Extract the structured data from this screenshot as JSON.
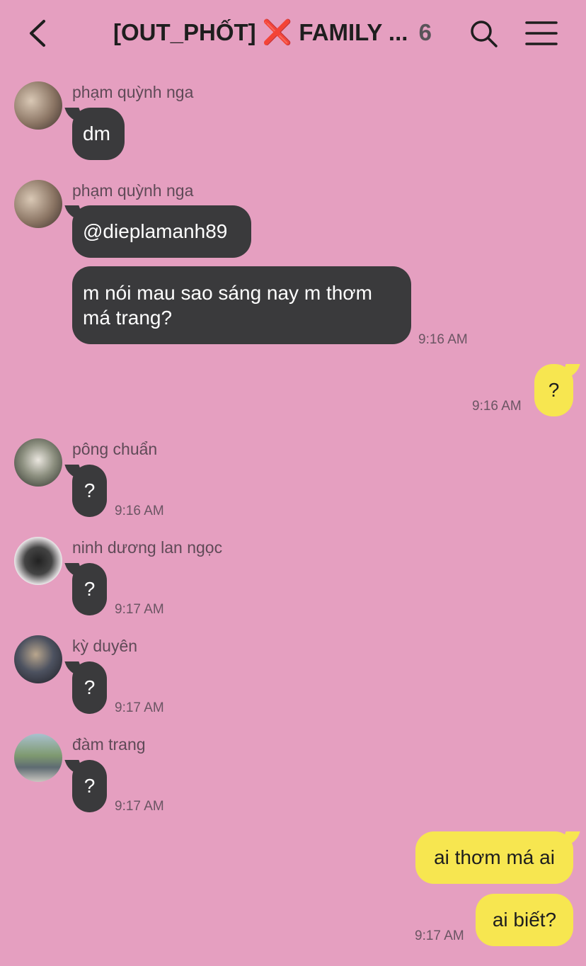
{
  "header": {
    "title": "[OUT_PHỐT]",
    "title_mark": "❌",
    "title_rest": "FAMILY ...",
    "member_count": "6"
  },
  "messages": [
    {
      "sender": "phạm quỳnh nga",
      "text": "dm"
    },
    {
      "sender": "phạm quỳnh nga",
      "text": "@dieplamanh89"
    },
    {
      "text_line1": "m nói mau sao sáng nay m thơm",
      "text_line2": "má trang?",
      "time": "9:16 AM"
    },
    {
      "text": "?",
      "time": "9:16 AM"
    },
    {
      "sender": "pông chuẩn",
      "text": "?",
      "time": "9:16 AM"
    },
    {
      "sender": "ninh dương lan ngọc",
      "text": "?",
      "time": "9:17 AM"
    },
    {
      "sender": "kỳ duyên",
      "text": "?",
      "time": "9:17 AM"
    },
    {
      "sender": "đàm trang",
      "text": "?",
      "time": "9:17 AM"
    },
    {
      "text": "ai thơm má ai"
    },
    {
      "text": "ai biết?",
      "time": "9:17 AM"
    }
  ]
}
